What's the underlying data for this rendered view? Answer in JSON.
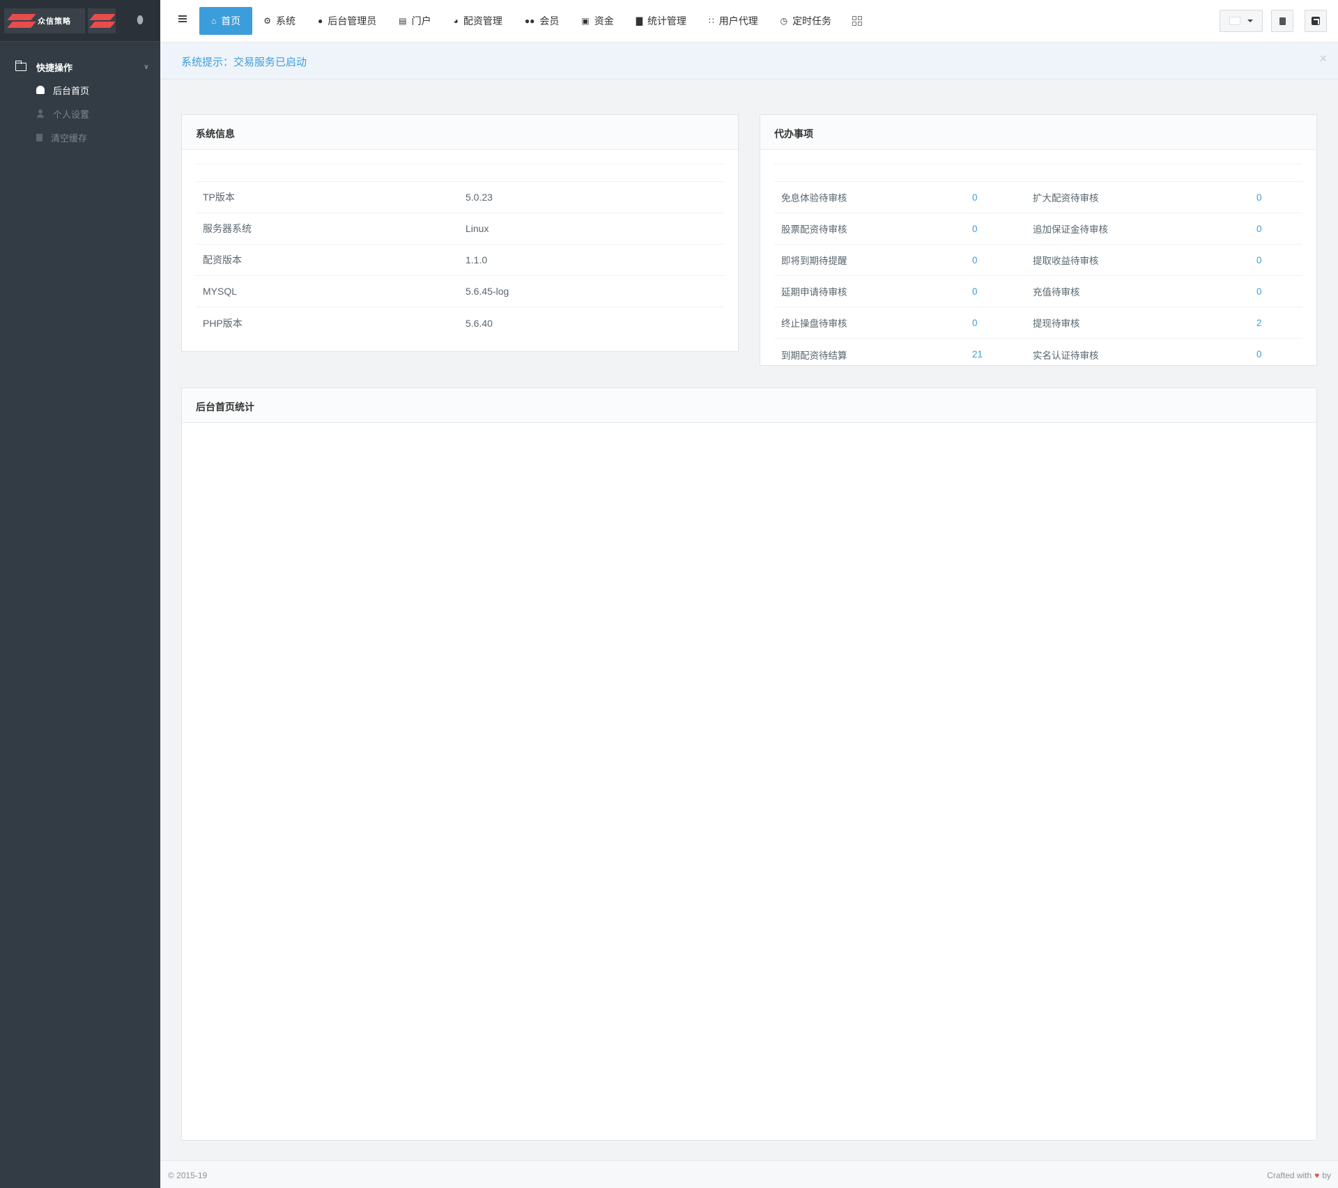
{
  "brand": {
    "logo_text": "众信策略"
  },
  "sidebar": {
    "group_label": "快捷操作",
    "items": [
      {
        "label": "后台首页"
      },
      {
        "label": "个人设置"
      },
      {
        "label": "清空缓存"
      }
    ]
  },
  "topnav": {
    "items": [
      {
        "label": "首页",
        "icon": "home-icon"
      },
      {
        "label": "系统",
        "icon": "gear-icon"
      },
      {
        "label": "后台管理员",
        "icon": "user-icon"
      },
      {
        "label": "门户",
        "icon": "newspaper-icon"
      },
      {
        "label": "配资管理",
        "icon": "pie-chart-icon"
      },
      {
        "label": "会员",
        "icon": "users-icon"
      },
      {
        "label": "资金",
        "icon": "money-icon"
      },
      {
        "label": "统计管理",
        "icon": "bar-chart-icon"
      },
      {
        "label": "用户代理",
        "icon": "sitemap-icon"
      },
      {
        "label": "定时任务",
        "icon": "clock-icon"
      }
    ]
  },
  "alert": {
    "text": "系统提示：交易服务已启动"
  },
  "system_info": {
    "title": "系统信息",
    "rows": [
      {
        "label": "TP版本",
        "value": "5.0.23"
      },
      {
        "label": "服务器系统",
        "value": "Linux"
      },
      {
        "label": "配资版本",
        "value": "1.1.0"
      },
      {
        "label": "MYSQL",
        "value": "5.6.45-log"
      },
      {
        "label": "PHP版本",
        "value": "5.6.40"
      }
    ]
  },
  "todo": {
    "title": "代办事项",
    "rows": [
      {
        "l1": "免息体验待审核",
        "v1": "0",
        "l2": "扩大配资待审核",
        "v2": "0"
      },
      {
        "l1": "股票配资待审核",
        "v1": "0",
        "l2": "追加保证金待审核",
        "v2": "0"
      },
      {
        "l1": "即将到期待提醒",
        "v1": "0",
        "l2": "提取收益待审核",
        "v2": "0"
      },
      {
        "l1": "延期申请待审核",
        "v1": "0",
        "l2": "充值待审核",
        "v2": "0"
      },
      {
        "l1": "终止操盘待审核",
        "v1": "0",
        "l2": "提现待审核",
        "v2": "2"
      },
      {
        "l1": "到期配资待结算",
        "v1": "21",
        "l2": "实名认证待审核",
        "v2": "0"
      }
    ]
  },
  "stats": {
    "title": "后台首页统计"
  },
  "footer": {
    "copyright": "© 2015-19",
    "crafted_prefix": "Crafted with",
    "crafted_suffix": "by"
  },
  "colors": {
    "accent": "#3c9ddb",
    "sidebar": "#333c44",
    "brand_red": "#e84c4c"
  }
}
